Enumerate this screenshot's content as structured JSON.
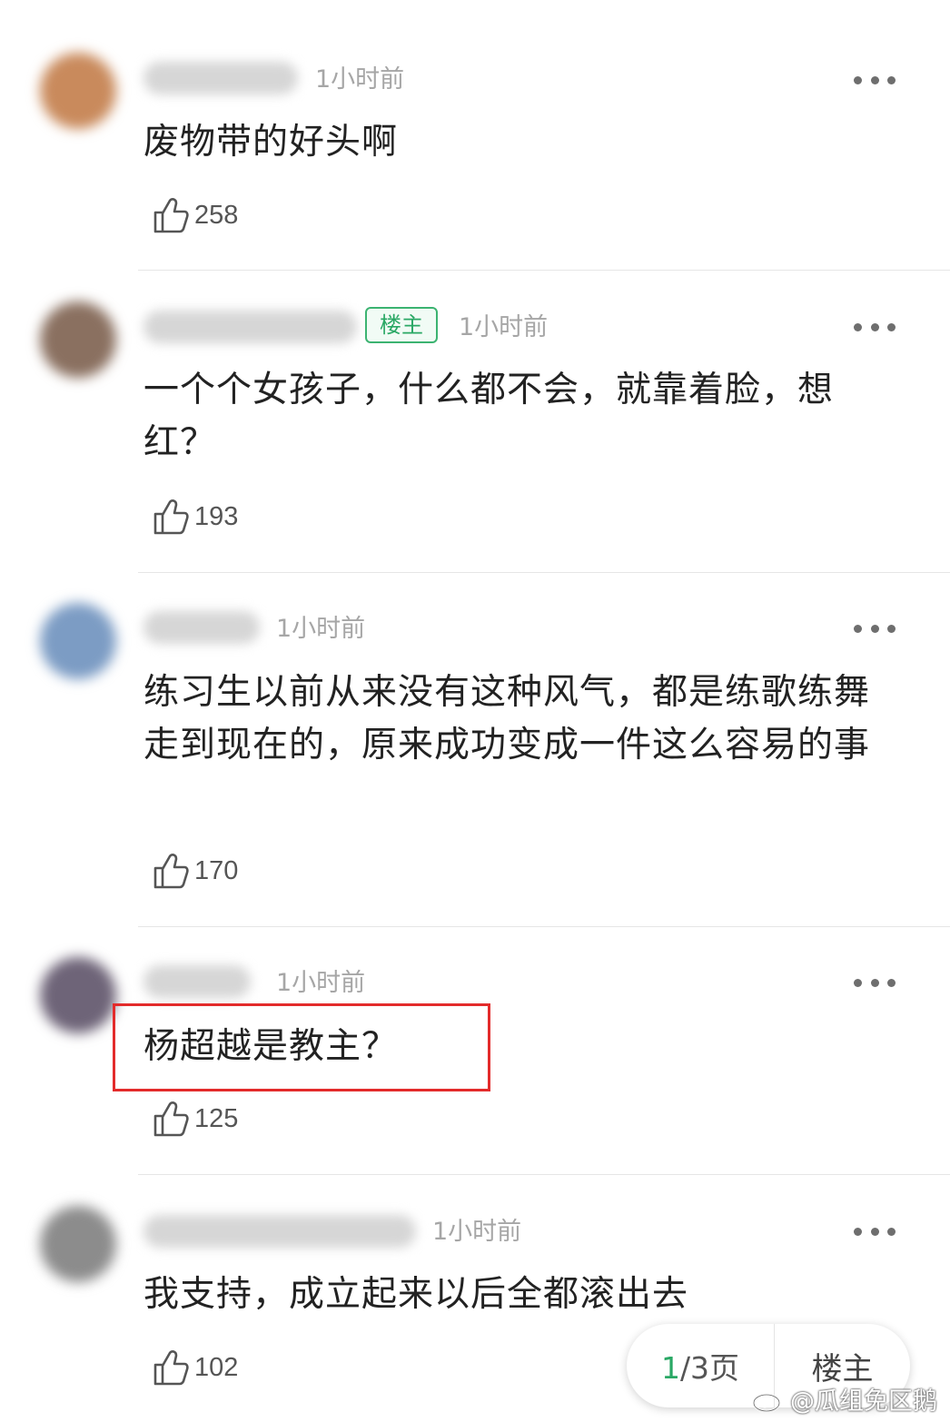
{
  "comments": [
    {
      "time": "1小时前",
      "content": "废物带的好头啊",
      "likes": "258",
      "avatar_color": "#c98a5c"
    },
    {
      "time": "1小时前",
      "badge": "楼主",
      "content": "一个个女孩子，什么都不会，就靠着脸，想红？",
      "likes": "193",
      "avatar_color": "#8a7060"
    },
    {
      "time": "1小时前",
      "content": "练习生以前从来没有这种风气，都是练歌练舞走到现在的，原来成功变成一件这么容易的事",
      "likes": "170",
      "avatar_color": "#7c9cc4"
    },
    {
      "time": "1小时前",
      "content": "杨超越是教主？",
      "likes": "125",
      "avatar_color": "#6e6478",
      "highlighted": true
    },
    {
      "time": "1小时前",
      "content": "我支持，成立起来以后全都滚出去",
      "likes": "102",
      "avatar_color": "#8c8c8c"
    }
  ],
  "pager": {
    "current": "1",
    "rest": "/3页",
    "host_label": "楼主"
  },
  "watermark": {
    "text": "@瓜组免区鹅",
    "icon": "weibo-icon"
  },
  "colors": {
    "accent_green": "#2aa865",
    "highlight_red": "#e32b2b",
    "time_gray": "#a6a6a6"
  },
  "icons": {
    "like": "thumbs-up-icon",
    "more": "more-dots-icon"
  }
}
